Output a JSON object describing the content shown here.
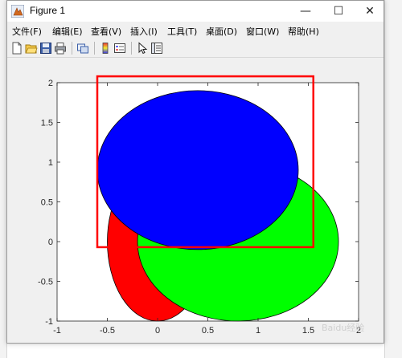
{
  "window": {
    "title": "Figure 1",
    "minimize_glyph": "—",
    "maximize_glyph": "☐",
    "close_glyph": "✕"
  },
  "menu": [
    {
      "label": "文件(F)"
    },
    {
      "label": "编辑(E)"
    },
    {
      "label": "查看(V)"
    },
    {
      "label": "插入(I)"
    },
    {
      "label": "工具(T)"
    },
    {
      "label": "桌面(D)"
    },
    {
      "label": "窗口(W)"
    },
    {
      "label": "帮助(H)"
    }
  ],
  "toolbar": [
    {
      "icon": "new-figure-icon"
    },
    {
      "icon": "open-file-icon"
    },
    {
      "icon": "save-figure-icon"
    },
    {
      "icon": "print-figure-icon"
    },
    {
      "icon": "link-plot-icon"
    },
    {
      "icon": "insert-colorbar-icon"
    },
    {
      "icon": "insert-legend-icon"
    },
    {
      "icon": "edit-plot-icon"
    },
    {
      "icon": "property-inspector-icon"
    }
  ],
  "chart_data": {
    "type": "scatter",
    "xlim": [
      -1,
      2
    ],
    "ylim": [
      -1,
      2
    ],
    "x_ticks": [
      -1,
      -0.5,
      0,
      0.5,
      1,
      1.5,
      2
    ],
    "y_ticks": [
      -1,
      -0.5,
      0,
      0.5,
      1,
      1.5,
      2
    ],
    "x_tick_labels": [
      "-1",
      "-0.5",
      "0",
      "0.5",
      "1",
      "1.5",
      "2"
    ],
    "y_tick_labels": [
      "-1",
      "-0.5",
      "0",
      "0.5",
      "1",
      "1.5",
      "2"
    ],
    "grid": false,
    "shapes": [
      {
        "shape": "ellipse",
        "fill": "#ff0000",
        "cx": 0.0,
        "cy": 0.0,
        "rx": 0.5,
        "ry": 1.0
      },
      {
        "shape": "ellipse",
        "fill": "#00ff00",
        "cx": 0.8,
        "cy": 0.0,
        "rx": 1.0,
        "ry": 1.0
      },
      {
        "shape": "ellipse",
        "fill": "#0000ff",
        "cx": 0.4,
        "cy": 0.9,
        "rx": 1.0,
        "ry": 1.0
      }
    ],
    "highlight_rect": {
      "x0": -0.6,
      "x1": 1.55,
      "y0": -0.07,
      "y1": 2.08,
      "color": "#ff0000"
    }
  },
  "watermark": "Baidu经验"
}
